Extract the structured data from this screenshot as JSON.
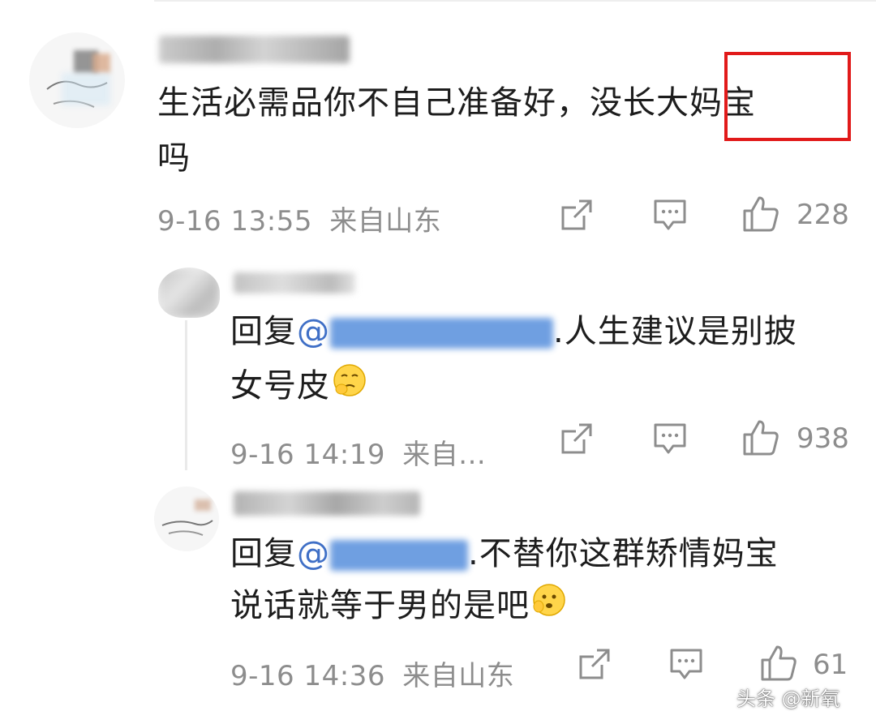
{
  "comments": [
    {
      "text_line1": "生活必需品你不自己准备好，没长大妈宝",
      "text_line2": "吗",
      "timestamp": "9-16 13:55",
      "location": "来自山东",
      "likes": "228",
      "highlight_word": "妈宝"
    },
    {
      "reply_prefix": "回复",
      "at_sign": "@",
      "text_line1_tail": ".人生建议是别披",
      "text_line2": "女号皮",
      "timestamp": "9-16 14:19",
      "location": "来自...",
      "likes": "938"
    },
    {
      "reply_prefix": "回复",
      "at_sign": "@",
      "text_line1_tail": ".不替你这群矫情妈宝",
      "text_line2": "说话就等于男的是吧",
      "timestamp": "9-16 14:36",
      "location": "来自山东",
      "likes": "61"
    }
  ],
  "icons": {
    "share": "share-icon",
    "comment": "comment-icon",
    "like": "thumbs-up-icon",
    "emoji": "emoji-face-icon"
  },
  "watermark": "头条 @新氧",
  "colors": {
    "highlight_border": "#e11a1a",
    "meta_text": "#8d8d8d",
    "mention": "#3f6fc6"
  }
}
